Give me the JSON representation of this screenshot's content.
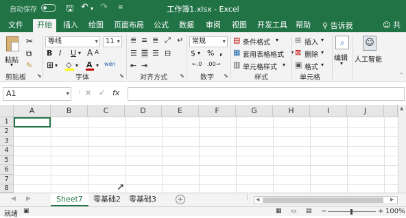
{
  "title_bar": {
    "autosave_label": "自动保存",
    "autosave_state": "off",
    "doc_title": "工作簿1.xlsx  -  Excel"
  },
  "ribbon_tabs": [
    "文件",
    "开始",
    "插入",
    "绘图",
    "页面布局",
    "公式",
    "数据",
    "审阅",
    "视图",
    "开发工具",
    "帮助"
  ],
  "active_tab": "开始",
  "tell_me": "告诉我",
  "share": "共享",
  "clipboard": {
    "paste": "粘贴",
    "label": "剪贴板"
  },
  "font": {
    "name": "等线",
    "size": "11",
    "bold": "B",
    "italic": "I",
    "underline": "U",
    "grow": "A",
    "shrink": "A",
    "color_letter": "A",
    "wen": "wén",
    "label": "字体"
  },
  "alignment": {
    "label": "对齐方式"
  },
  "number": {
    "format": "常规",
    "percent": "%",
    "comma": ",",
    "label": "数字"
  },
  "styles": {
    "conditional": "条件格式",
    "table": "套用表格格式",
    "cell": "单元格样式",
    "label": "样式"
  },
  "cells": {
    "insert": "插入",
    "delete": "删除",
    "format": "格式",
    "label": "单元格"
  },
  "editing": {
    "label": "编辑"
  },
  "ai": {
    "label": "人工智能"
  },
  "formula_bar": {
    "name_box": "A1",
    "cancel": "✕",
    "enter": "✓",
    "fx": "fx",
    "formula": ""
  },
  "columns": [
    "A",
    "B",
    "C",
    "D",
    "E",
    "F",
    "G",
    "H",
    "I",
    "J"
  ],
  "rows": [
    "1",
    "2",
    "3",
    "4",
    "5",
    "6",
    "7",
    "8"
  ],
  "sheets": [
    "Sheet7",
    "零基础2",
    "零基础3"
  ],
  "active_sheet": "Sheet7",
  "add_sheet": "+",
  "status": {
    "ready": "就绪",
    "zoom": "100%",
    "minus": "−",
    "plus": "+"
  },
  "colors": {
    "accent": "#217346",
    "ribbon_bg": "#f3f3f3",
    "font_color_bar": "#c00000",
    "fill_bar": "#ffff00"
  }
}
